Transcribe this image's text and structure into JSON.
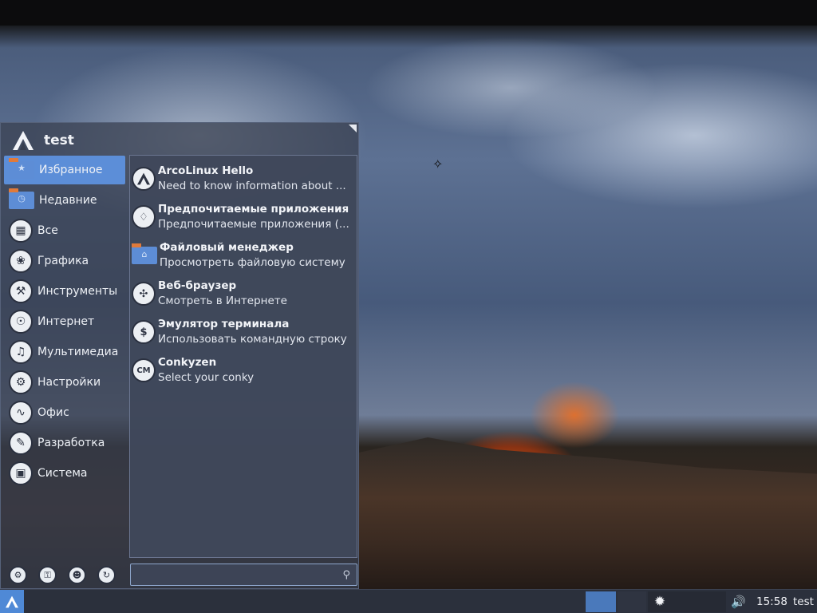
{
  "menu": {
    "user_name": "test",
    "categories": [
      {
        "label": "Избранное",
        "icon": "star-folder-icon",
        "active": true
      },
      {
        "label": "Недавние",
        "icon": "clock-folder-icon"
      },
      {
        "label": "Все",
        "icon": "all-apps-icon"
      },
      {
        "label": "Графика",
        "icon": "palette-icon"
      },
      {
        "label": "Инструменты",
        "icon": "toolbox-icon"
      },
      {
        "label": "Интернет",
        "icon": "globe-icon"
      },
      {
        "label": "Мультимедиа",
        "icon": "music-note-icon"
      },
      {
        "label": "Настройки",
        "icon": "gear-icon"
      },
      {
        "label": "Офис",
        "icon": "chart-line-icon"
      },
      {
        "label": "Разработка",
        "icon": "developer-icon"
      },
      {
        "label": "Система",
        "icon": "system-icon"
      }
    ],
    "apps": [
      {
        "name": "ArcoLinux Hello",
        "desc": "Need to know information about ...",
        "icon": "arcolinux-logo-icon"
      },
      {
        "name": "Предпочитаемые приложения",
        "desc": "Предпочитаемые приложения (...",
        "icon": "diamond-icon"
      },
      {
        "name": "Файловый менеджер",
        "desc": "Просмотреть файловую систему",
        "icon": "home-folder-icon"
      },
      {
        "name": "Веб-браузер",
        "desc": "Смотреть в Интернете",
        "icon": "compass-icon"
      },
      {
        "name": "Эмулятор терминала",
        "desc": "Использовать командную строку",
        "icon": "terminal-icon"
      },
      {
        "name": "Conkyzen",
        "desc": "Select your conky",
        "icon": "conky-icon"
      }
    ],
    "app_glyphs": {
      "conky": "CM",
      "terminal": "$"
    },
    "search": {
      "value": "",
      "placeholder": ""
    },
    "actions": [
      "settings-gear-icon",
      "lock-icon",
      "switch-user-icon",
      "logout-icon"
    ]
  },
  "taskbar": {
    "clock": "15:58",
    "user": "test"
  },
  "colors": {
    "accent": "#5c8ed8",
    "panel": "#2b303c",
    "menu_bg": "#383f50"
  }
}
